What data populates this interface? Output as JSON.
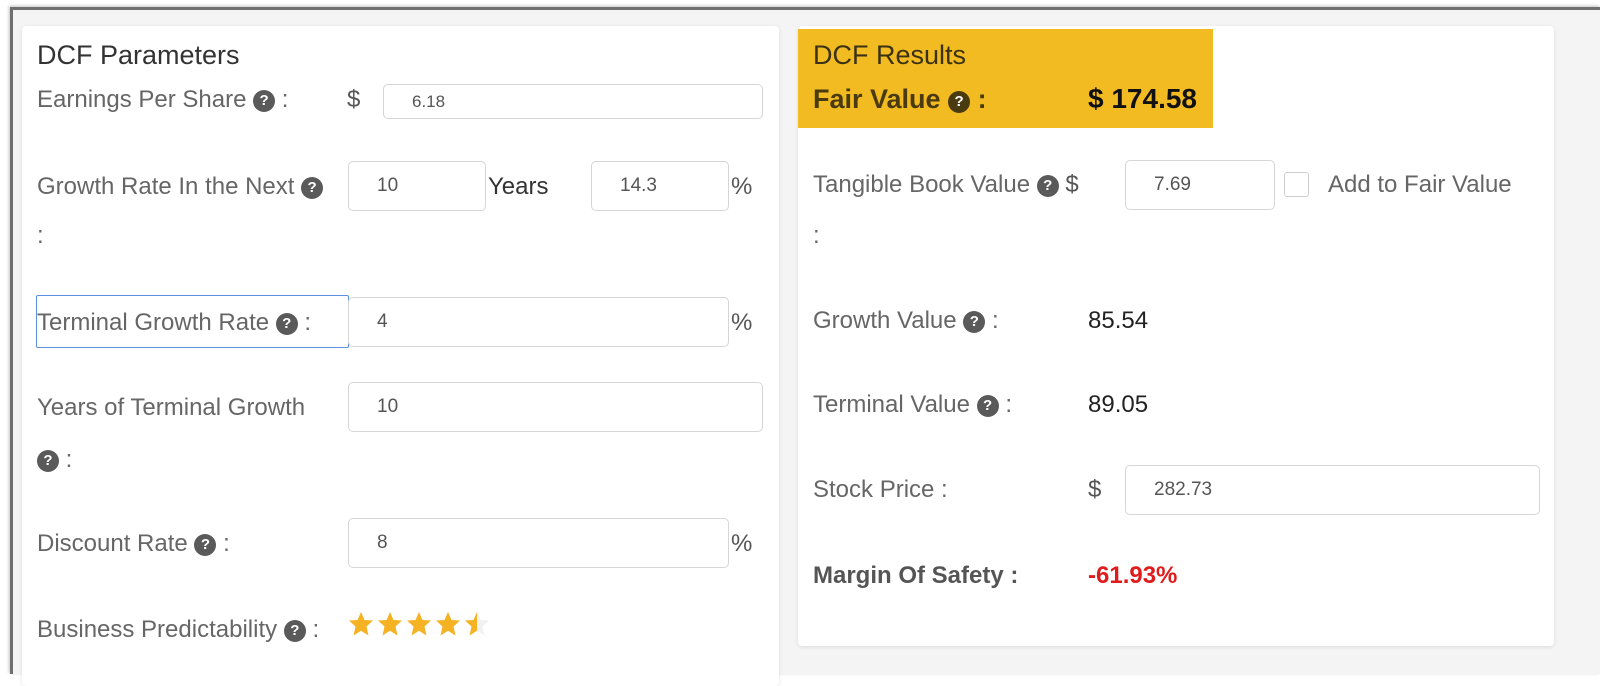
{
  "params": {
    "title": "DCF Parameters",
    "eps": {
      "label": "Earnings Per Share",
      "colon": ":",
      "currency": "$",
      "value": "6.18"
    },
    "growth": {
      "label": "Growth Rate In the Next",
      "colon": ":",
      "years_value": "10",
      "years_label": "Years",
      "rate_value": "14.3",
      "unit": "%"
    },
    "terminal_growth": {
      "label": "Terminal Growth Rate",
      "colon": ":",
      "value": "4",
      "unit": "%"
    },
    "terminal_years": {
      "label": "Years of Terminal Growth",
      "colon": ":",
      "value": "10"
    },
    "discount": {
      "label": "Discount Rate",
      "colon": ":",
      "value": "8",
      "unit": "%"
    },
    "predictability": {
      "label": "Business Predictability",
      "colon": ":",
      "rating": 4.5,
      "max": 5
    },
    "help_glyph": "?"
  },
  "results": {
    "title": "DCF Results",
    "fair_value": {
      "label": "Fair Value",
      "colon": ":",
      "value": "$ 174.58"
    },
    "tangible_book": {
      "label": "Tangible Book Value",
      "currency": "$",
      "colon": ":",
      "value": "7.69",
      "checkbox_label": "Add to Fair Value",
      "checked": false
    },
    "growth_value": {
      "label": "Growth Value",
      "colon": ":",
      "value": "85.54"
    },
    "terminal_value": {
      "label": "Terminal Value",
      "colon": ":",
      "value": "89.05"
    },
    "stock_price": {
      "label": "Stock Price :",
      "currency": "$",
      "value": "282.73"
    },
    "margin_of_safety": {
      "label": "Margin Of Safety :",
      "value": "-61.93%"
    }
  },
  "colors": {
    "accent": "#f2bb21",
    "negative": "#e01b1b",
    "star": "#f5b324",
    "focus": "#5b8fe0"
  }
}
